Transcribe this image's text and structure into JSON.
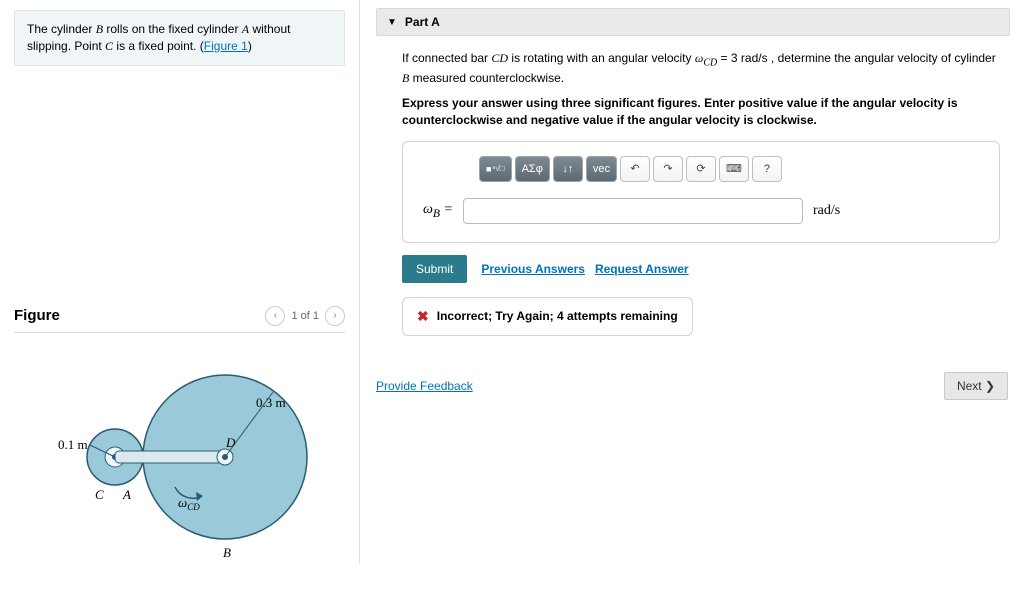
{
  "intro": {
    "text_before": "The cylinder ",
    "B": "B",
    "text_mid1": " rolls on the fixed cylinder ",
    "A": "A",
    "text_mid2": " without slipping. Point ",
    "C": "C",
    "text_mid3": " is a fixed point. (",
    "figlink": "Figure 1",
    "text_after": ")"
  },
  "figure": {
    "title": "Figure",
    "pager": "1 of 1",
    "labels": {
      "r_small": "0.1 m",
      "r_big": "0.3 m",
      "A": "A",
      "B": "B",
      "C": "C",
      "D": "D",
      "omega": "ω",
      "omega_sub": "CD"
    }
  },
  "part": {
    "title": "Part A"
  },
  "question": {
    "p1a": "If connected bar ",
    "CD": "CD",
    "p1b": " is rotating with an angular velocity ",
    "omega": "ω",
    "omega_sub": "CD",
    "p1c": " = 3 ",
    "units_omega": "rad/s",
    "p1d": " , determine the angular velocity of cylinder ",
    "B2": "B",
    "p1e": " measured counterclockwise.",
    "p2": "Express your answer using three significant figures. Enter positive value if the angular velocity is counterclockwise and negative value if the angular velocity is clockwise."
  },
  "toolbar": {
    "frac": "x√□",
    "greek": "ΑΣφ",
    "updown": "↓↑",
    "vec": "vec",
    "undo": "↶",
    "redo": "↷",
    "reset": "⟳",
    "keyboard": "⌨",
    "help": "?"
  },
  "answer": {
    "lhs_sym": "ω",
    "lhs_sub": "B",
    "lhs_eq": " =",
    "value": "",
    "unit": "rad/s"
  },
  "buttons": {
    "submit": "Submit",
    "prev": "Previous Answers",
    "req": "Request Answer"
  },
  "feedback": {
    "icon": "✖",
    "msg": "Incorrect; Try Again; 4 attempts remaining"
  },
  "bottom": {
    "provide": "Provide Feedback",
    "next": "Next ❯"
  },
  "chart_data": {
    "type": "diagram",
    "description": "Small fixed cylinder A (radius 0.1 m) centered at C; large cylinder B (radius 0.3 m) rolling on A without slipping; rigid bar CD connecting centers; angular velocity of bar ω_CD = 3 rad/s.",
    "cylinder_A_radius_m": 0.1,
    "cylinder_B_radius_m": 0.3,
    "bar": "CD",
    "omega_CD_rad_per_s": 3
  }
}
